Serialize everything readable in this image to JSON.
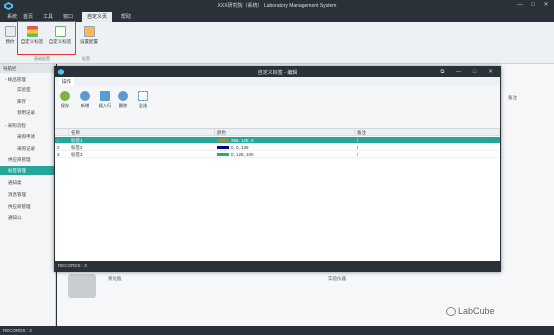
{
  "window": {
    "title": "XXX研究院（系统）  Laboratory Management System",
    "min": "—",
    "max": "□",
    "close": "✕"
  },
  "menu": {
    "tabs": [
      "系统",
      "首页",
      "工具",
      "窗口",
      "自定义页",
      "帮助"
    ]
  },
  "ribbon": {
    "buttons": [
      {
        "label": "预约",
        "icon": "calendar-icon"
      },
      {
        "label": "自定义标签",
        "icon": "label-icon"
      },
      {
        "label": "自定义标签",
        "icon": "label-icon"
      },
      {
        "label": "设置配置",
        "icon": "settings-icon"
      }
    ],
    "groups": [
      "基础配置",
      "配置"
    ]
  },
  "leftnav": {
    "header": "导航栏",
    "items": [
      {
        "label": "- 样品管理",
        "active": false
      },
      {
        "label": "实验室",
        "active": false
      },
      {
        "label": "库存",
        "active": false
      },
      {
        "label": "领用记录",
        "active": false
      },
      {
        "label": "- 采购流程",
        "active": false
      },
      {
        "label": "采购申请",
        "active": false
      },
      {
        "label": "采购记录",
        "active": false
      },
      {
        "label": "供应商管理",
        "active": false
      },
      {
        "label": "标签管理",
        "active": true
      },
      {
        "label": "通知类",
        "active": false
      },
      {
        "label": "消息管理",
        "active": false
      },
      {
        "label": "供应商管理",
        "active": false
      },
      {
        "label": "通知公",
        "active": false
      }
    ]
  },
  "background_grid": {
    "header_right": "备注",
    "row_label_1": "蒸化瓶",
    "row_label_2": "实验仪器"
  },
  "dialog": {
    "title": "自定义标签 - 编辑",
    "tab": "操作",
    "toolbar": [
      {
        "label": "保存",
        "icon": "save-icon",
        "color": "#7cb342"
      },
      {
        "label": "新增",
        "icon": "add-icon",
        "color": "#5c9bd1"
      },
      {
        "label": "插入行",
        "icon": "insert-row-icon",
        "color": "#5c9bd1"
      },
      {
        "label": "删除",
        "icon": "delete-icon",
        "color": "#5c9bd1"
      },
      {
        "label": "全选",
        "icon": "select-all-icon",
        "color": "#5c9bd1"
      }
    ],
    "columns": [
      "",
      "名称",
      "颜色",
      "备注"
    ],
    "rows": [
      {
        "no": "1",
        "name": "标签1",
        "color_hex": "#e07b00",
        "color_text": "255, 128, 0",
        "note": "/"
      },
      {
        "no": "2",
        "name": "标签2",
        "color_hex": "#00008b",
        "color_text": "0, 0, 139",
        "note": "/"
      },
      {
        "no": "3",
        "name": "标签3",
        "color_hex": "#26a69a",
        "color_text": "0, 128, 100",
        "note": "/"
      }
    ],
    "status": "RECORDS : 3"
  },
  "statusbar": {
    "text": "RECORDS : 3"
  },
  "watermark": {
    "text": "LabCube"
  }
}
